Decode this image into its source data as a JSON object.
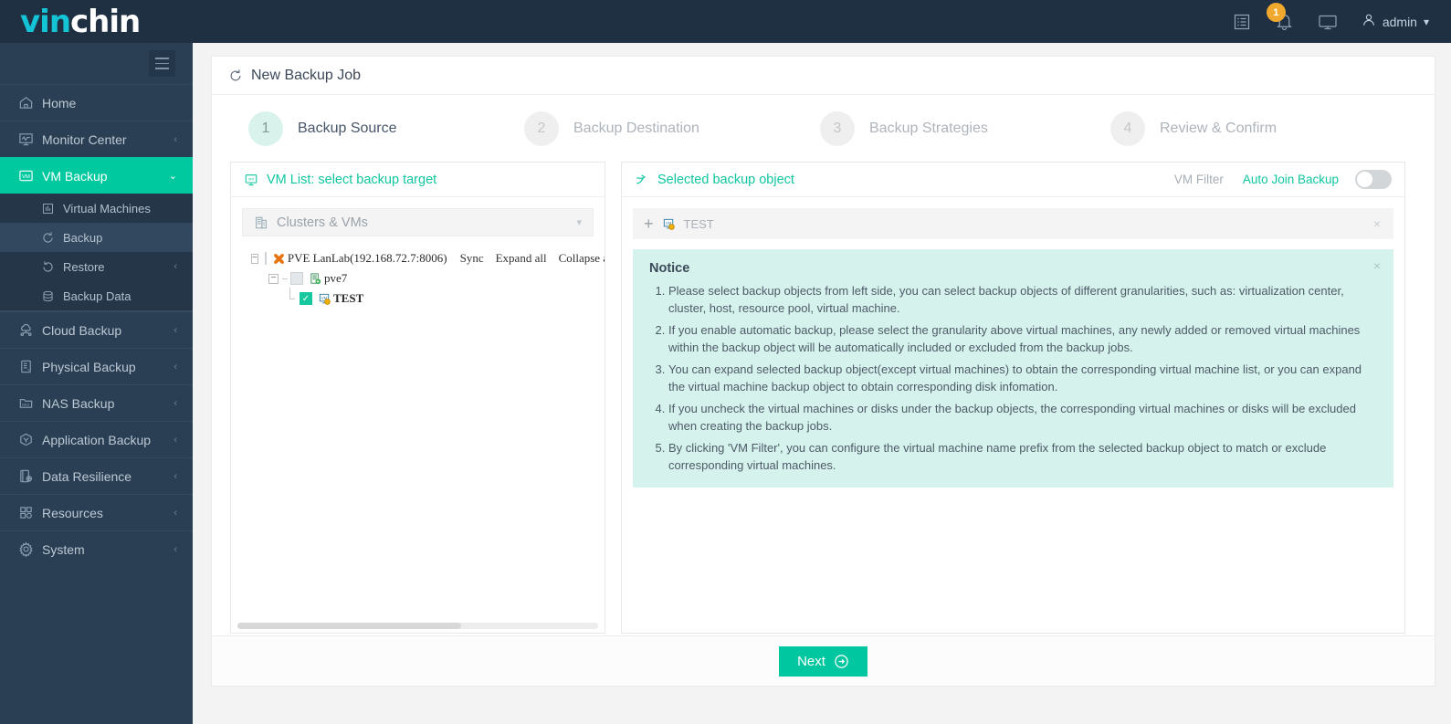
{
  "brand": {
    "logo_part1": "vin",
    "logo_part2": "chin",
    "accent": "#00c79f",
    "logo_accent": "#15c3d6"
  },
  "topbar": {
    "icons": [
      {
        "name": "tasks-icon",
        "label": "Tasks"
      },
      {
        "name": "bell-icon",
        "label": "Notifications",
        "badge": "1"
      },
      {
        "name": "monitor-icon",
        "label": "Console"
      }
    ],
    "user": {
      "name": "admin",
      "caret": "⌄"
    }
  },
  "sidebar": {
    "toggle_label": "menu-toggle",
    "items": [
      {
        "label": "Home",
        "icon": "home-icon",
        "arrow": "",
        "active": false
      },
      {
        "label": "Monitor Center",
        "icon": "monitor-center-icon",
        "arrow": "‹",
        "active": false
      },
      {
        "label": "VM Backup",
        "icon": "vm-icon",
        "arrow": "⌄",
        "active": true
      },
      {
        "label": "Cloud Backup",
        "icon": "cloud-icon",
        "arrow": "‹",
        "active": false
      },
      {
        "label": "Physical Backup",
        "icon": "server-icon",
        "arrow": "‹",
        "active": false
      },
      {
        "label": "NAS Backup",
        "icon": "nas-icon",
        "arrow": "‹",
        "active": false
      },
      {
        "label": "Application Backup",
        "icon": "app-icon",
        "arrow": "‹",
        "active": false
      },
      {
        "label": "Data Resilience",
        "icon": "resilience-icon",
        "arrow": "‹",
        "active": false
      },
      {
        "label": "Resources",
        "icon": "resources-icon",
        "arrow": "‹",
        "active": false
      },
      {
        "label": "System",
        "icon": "gear-icon",
        "arrow": "‹",
        "active": false
      }
    ],
    "subitems": [
      {
        "label": "Virtual Machines",
        "icon": "chart-icon",
        "arrow": "",
        "selected": false
      },
      {
        "label": "Backup",
        "icon": "refresh-icon",
        "arrow": "",
        "selected": true
      },
      {
        "label": "Restore",
        "icon": "restore-icon",
        "arrow": "‹",
        "selected": false
      },
      {
        "label": "Backup Data",
        "icon": "database-icon",
        "arrow": "",
        "selected": false
      }
    ]
  },
  "page": {
    "title": "New Backup Job",
    "title_icon": "refresh-icon"
  },
  "steps": [
    {
      "num": "1",
      "label": "Backup Source",
      "state": "active"
    },
    {
      "num": "2",
      "label": "Backup Destination",
      "state": "idle"
    },
    {
      "num": "3",
      "label": "Backup Strategies",
      "state": "idle"
    },
    {
      "num": "4",
      "label": "Review & Confirm",
      "state": "idle"
    }
  ],
  "left_panel": {
    "title": "VM List: select backup target",
    "title_icon": "vm-list-icon",
    "selector": {
      "value": "Clusters & VMs",
      "icon": "cluster-icon",
      "chevron": "⌄"
    },
    "tree_actions": [
      "Sync",
      "Expand all",
      "Collapse all"
    ],
    "tree": [
      {
        "level": 1,
        "expander": "−",
        "checkbox": "unchecked",
        "icon": "pve-cross-icon",
        "label": "PVE LanLab(192.168.72.7:8006)"
      },
      {
        "level": 2,
        "expander": "−",
        "checkbox": "unchecked",
        "icon": "host-icon",
        "label": "pve7"
      },
      {
        "level": 3,
        "expander": "",
        "checkbox": "checked",
        "icon": "vm-yellow-icon",
        "label": "TEST"
      }
    ]
  },
  "right_panel": {
    "title": "Selected backup object",
    "title_icon": "arrow-branch-icon",
    "vm_filter_label": "VM Filter",
    "auto_join_label": "Auto Join Backup",
    "auto_join_state": "off",
    "selected_objects": [
      {
        "plus": "+",
        "icon": "vm-yellow-icon",
        "label": "TEST",
        "close": "×"
      }
    ],
    "notice": {
      "title": "Notice",
      "close": "×",
      "items": [
        "Please select backup objects from left side, you can select backup objects of different granularities, such as: virtualization center, cluster, host, resource pool, virtual machine.",
        "If you enable automatic backup, please select the granularity above virtual machines, any newly added or removed virtual machines within the backup object will be automatically included or excluded from the backup jobs.",
        "You can expand selected backup object(except virtual machines) to obtain the corresponding virtual machine list, or you can expand the virtual machine backup object to obtain corresponding disk infomation.",
        "If you uncheck the virtual machines or disks under the backup objects, the corresponding virtual machines or disks will be excluded when creating the backup jobs.",
        "By clicking 'VM Filter', you can configure the virtual machine name prefix from the selected backup object to match or exclude corresponding virtual machines."
      ]
    }
  },
  "footer": {
    "next_label": "Next",
    "next_icon": "arrow-right-circle-icon"
  }
}
